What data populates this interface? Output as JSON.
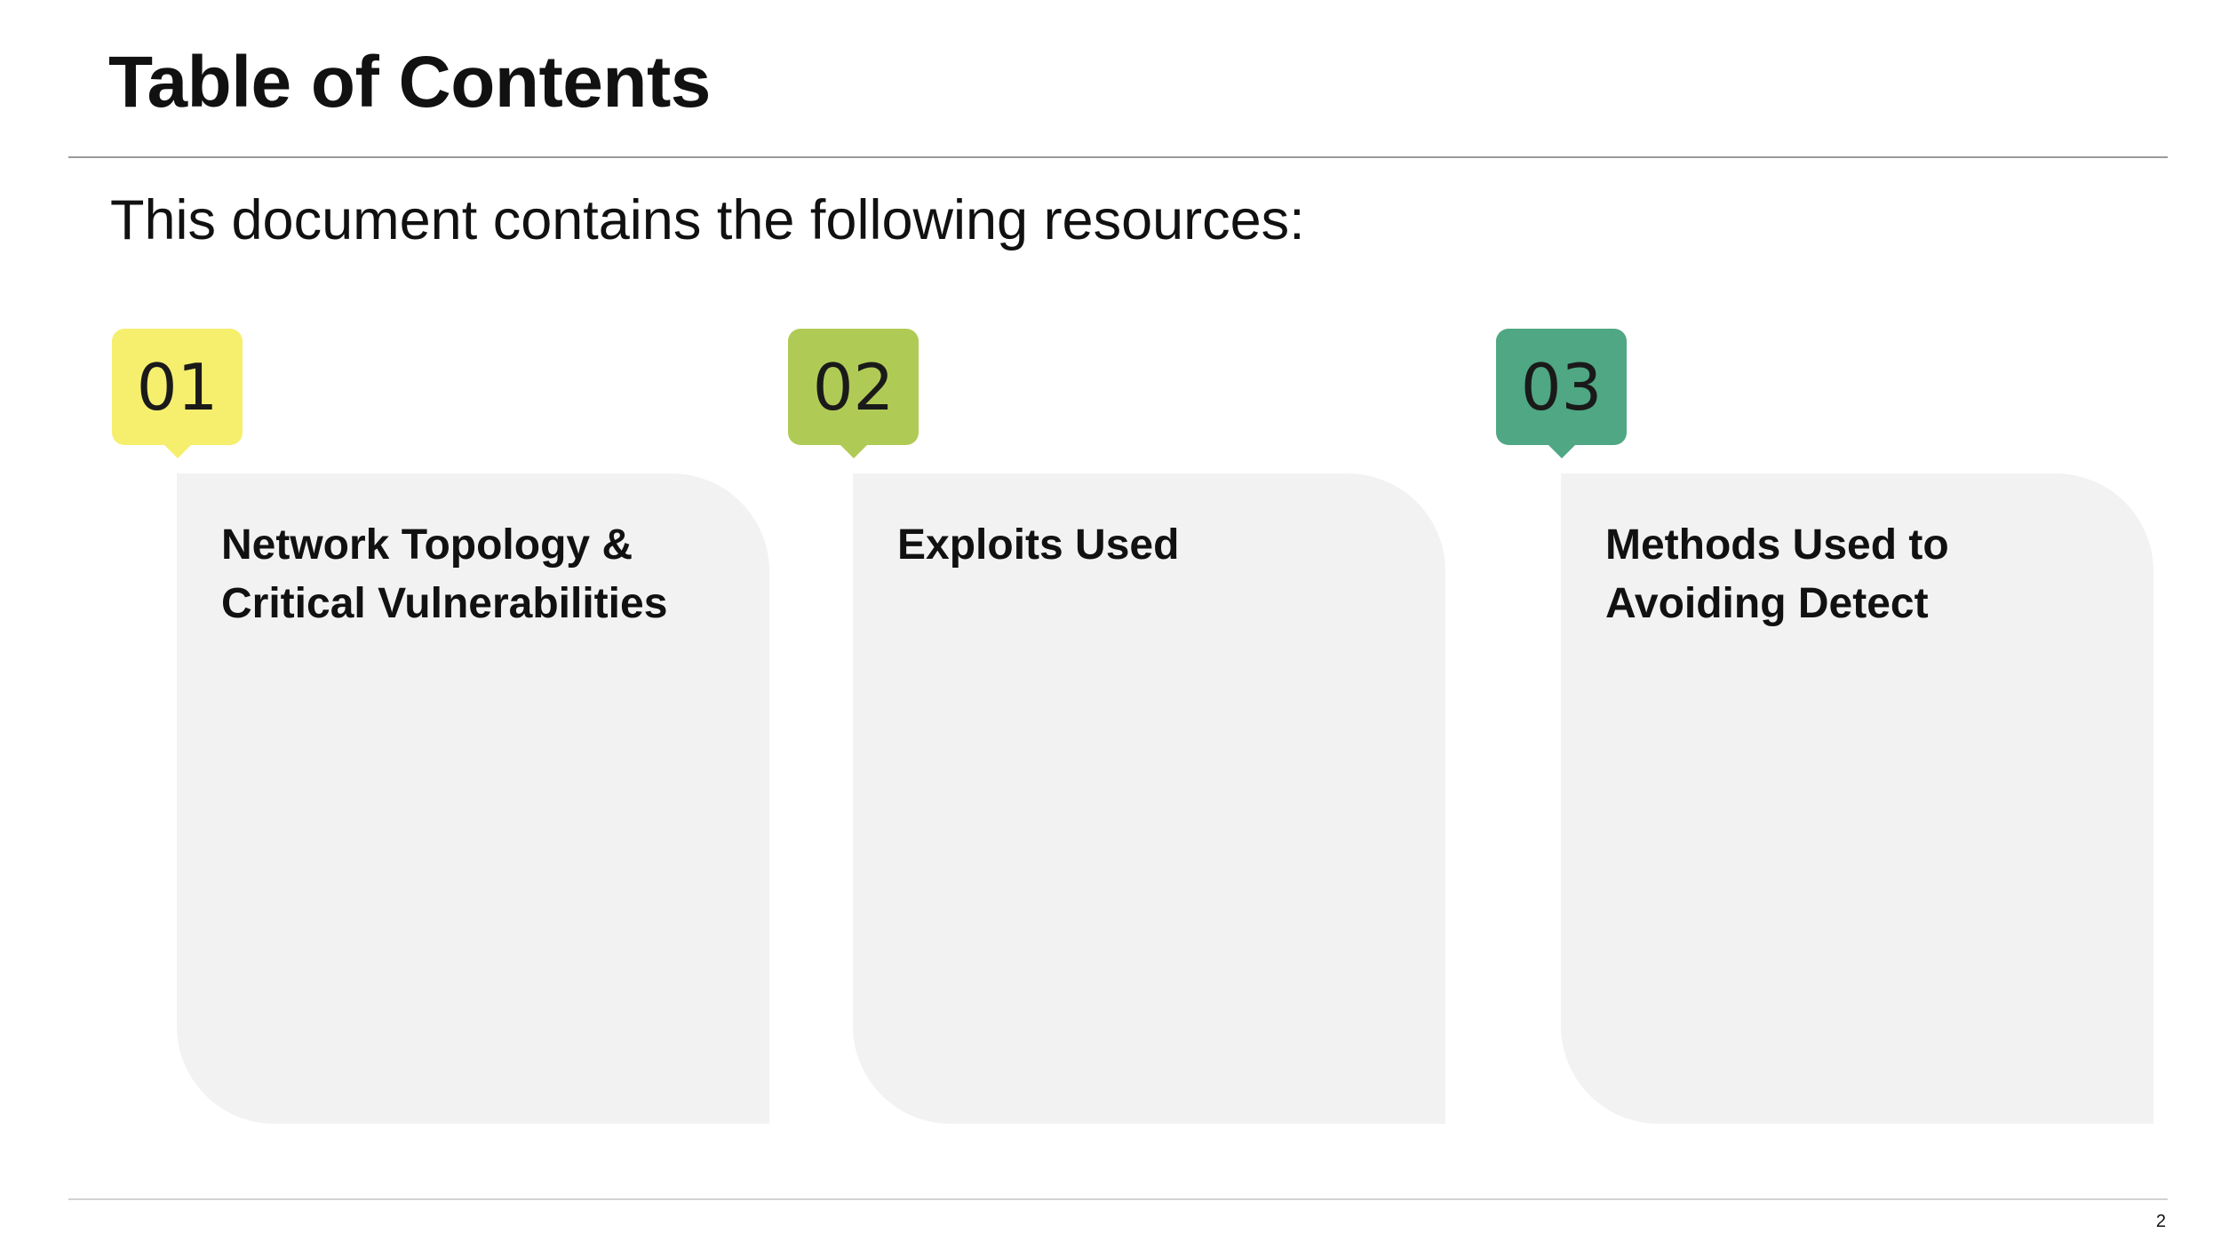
{
  "slide": {
    "title": "Table of Contents",
    "subtitle": "This document contains the following resources:",
    "page_number": "2"
  },
  "items": [
    {
      "number": "01",
      "heading": "Network Topology & Critical Vulnerabilities",
      "color": "#f6ef6e"
    },
    {
      "number": "02",
      "heading": "Exploits Used",
      "color": "#b0cb55"
    },
    {
      "number": "03",
      "heading": "Methods Used to Avoiding Detect",
      "color": "#4fa783"
    }
  ]
}
